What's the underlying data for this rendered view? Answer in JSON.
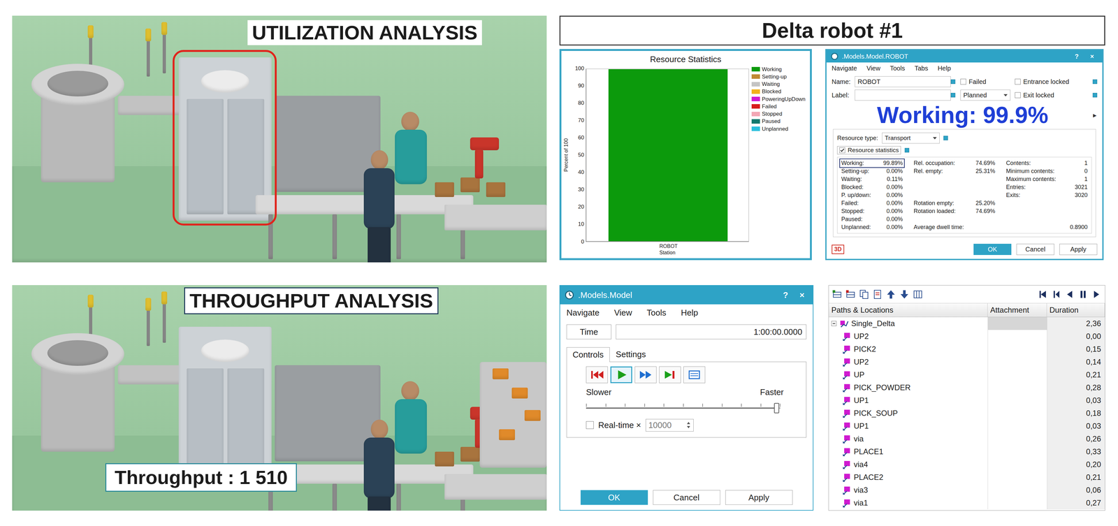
{
  "utilization_scene": {
    "title": "UTILIZATION ANALYSIS"
  },
  "throughput_scene": {
    "title": "THROUGHPUT ANALYSIS",
    "label": "Throughput : 1 510"
  },
  "header": {
    "title": "Delta robot #1"
  },
  "chart": {
    "title": "Resource Statistics",
    "y_axis_label": "Percent of 100",
    "y_ticks": [
      "100",
      "90",
      "80",
      "70",
      "60",
      "50",
      "40",
      "30",
      "20",
      "10",
      "0"
    ],
    "categories": [
      "ROBOT",
      "Station"
    ],
    "legend": [
      {
        "label": "Working",
        "color": "#0c9a0c"
      },
      {
        "label": "Setting-up",
        "color": "#c08a34"
      },
      {
        "label": "Waiting",
        "color": "#c4c4c4"
      },
      {
        "label": "Blocked",
        "color": "#f2b21c"
      },
      {
        "label": "PoweringUpDown",
        "color": "#d01ad0"
      },
      {
        "label": "Failed",
        "color": "#d81c1c"
      },
      {
        "label": "Stopped",
        "color": "#f3a7b5"
      },
      {
        "label": "Paused",
        "color": "#137a6e"
      },
      {
        "label": "Unplanned",
        "color": "#2bbfdc"
      }
    ],
    "series": [
      {
        "name": "Working",
        "values": [
          99.89
        ],
        "color": "#0c9a0c"
      },
      {
        "name": "Waiting",
        "values": [
          0.11
        ],
        "color": "#c4c4c4"
      }
    ]
  },
  "robot_dialog": {
    "title": ".Models.Model.ROBOT",
    "title_buttons": [
      "?",
      "×"
    ],
    "menu": [
      "Navigate",
      "View",
      "Tools",
      "Tabs",
      "Help"
    ],
    "name": {
      "label": "Name:",
      "value": "ROBOT"
    },
    "label": {
      "label": "Label:",
      "value": ""
    },
    "checks": [
      {
        "label": "Failed",
        "checked": false
      },
      {
        "label": "Entrance locked",
        "checked": false
      },
      {
        "label": "Exit locked",
        "checked": false
      }
    ],
    "mode": "Planned",
    "callout": "Working: 99.9%",
    "expand": "▸",
    "resource_type": {
      "label": "Resource type:",
      "value": "Transport"
    },
    "statistics": {
      "label": "Resource statistics",
      "checked": true
    },
    "stats_rows": [
      [
        {
          "kind": "pair",
          "label": "Working:",
          "value": "99.89%",
          "selected": true
        },
        {
          "kind": "pair",
          "label": "Rel. occupation:",
          "value": "74.69%",
          "selected": false
        },
        {
          "kind": "pair",
          "label": "Contents:",
          "value": "1",
          "selected": false
        }
      ],
      [
        {
          "kind": "pair",
          "label": "Setting-up:",
          "value": "0.00%",
          "selected": false
        },
        {
          "kind": "pair",
          "label": "Rel. empty:",
          "value": "25.31%",
          "selected": false
        },
        {
          "kind": "pair",
          "label": "Minimum contents:",
          "value": "0",
          "selected": false
        }
      ],
      [
        {
          "kind": "pair",
          "label": "Waiting:",
          "value": "0.11%",
          "selected": false
        },
        {
          "kind": "empty"
        },
        {
          "kind": "pair",
          "label": "Maximum contents:",
          "value": "1",
          "selected": false
        }
      ],
      [
        {
          "kind": "pair",
          "label": "Blocked:",
          "value": "0.00%",
          "selected": false
        },
        {
          "kind": "empty"
        },
        {
          "kind": "pair",
          "label": "Entries:",
          "value": "3021",
          "selected": false
        }
      ],
      [
        {
          "kind": "pair",
          "label": "P. up/down:",
          "value": "0.00%",
          "selected": false
        },
        {
          "kind": "empty"
        },
        {
          "kind": "pair",
          "label": "Exits:",
          "value": "3020",
          "selected": false
        }
      ],
      [
        {
          "kind": "pair",
          "label": "Failed:",
          "value": "0.00%",
          "selected": false
        },
        {
          "kind": "pair",
          "label": "Rotation empty:",
          "value": "25.20%",
          "selected": false
        },
        {
          "kind": "empty"
        }
      ],
      [
        {
          "kind": "pair",
          "label": "Stopped:",
          "value": "0.00%",
          "selected": false
        },
        {
          "kind": "pair",
          "label": "Rotation loaded:",
          "value": "74.69%",
          "selected": false
        },
        {
          "kind": "empty"
        }
      ],
      [
        {
          "kind": "pair",
          "label": "Paused:",
          "value": "0.00%",
          "selected": false
        },
        {
          "kind": "empty"
        },
        {
          "kind": "empty"
        }
      ],
      [
        {
          "kind": "pair",
          "label": "Unplanned:",
          "value": "0.00%",
          "selected": false
        },
        {
          "kind": "wide",
          "label": "Average dwell time:",
          "value": "0.8900",
          "selected": false
        }
      ]
    ],
    "tab_3d": "3D",
    "buttons": [
      "OK",
      "Cancel",
      "Apply"
    ]
  },
  "model_dialog": {
    "title": ".Models.Model",
    "title_buttons": [
      "?",
      "×"
    ],
    "menu": [
      "Navigate",
      "View",
      "Tools",
      "Help"
    ],
    "time": {
      "button": "Time",
      "value": "1:00:00.0000"
    },
    "tabs": [
      {
        "label": "Controls",
        "selected": true
      },
      {
        "label": "Settings",
        "selected": false
      }
    ],
    "controls": [
      {
        "kind": "reset",
        "selected": false
      },
      {
        "kind": "play",
        "selected": true
      },
      {
        "kind": "fast",
        "selected": false
      },
      {
        "kind": "step",
        "selected": false
      },
      {
        "kind": "list",
        "selected": false
      }
    ],
    "speed": {
      "min_label": "Slower",
      "max_label": "Faster",
      "level": 0.98
    },
    "realtime": {
      "label": "Real-time ×",
      "checked": false,
      "value": "10000"
    },
    "buttons": [
      "OK",
      "Cancel",
      "Apply"
    ]
  },
  "paths_table": {
    "columns": [
      "Paths & Locations",
      "Attachment",
      "Duration"
    ],
    "rows": [
      {
        "kind": "path",
        "name": "Single_Delta",
        "duration": "2,36",
        "expanded": true
      },
      {
        "kind": "location",
        "name": "UP2",
        "duration": "0,00"
      },
      {
        "kind": "location",
        "name": "PICK2",
        "duration": "0,15"
      },
      {
        "kind": "location",
        "name": "UP2",
        "duration": "0,14"
      },
      {
        "kind": "location",
        "name": "UP",
        "duration": "0,21"
      },
      {
        "kind": "location",
        "name": "PICK_POWDER",
        "duration": "0,28"
      },
      {
        "kind": "location",
        "name": "UP1",
        "duration": "0,03"
      },
      {
        "kind": "location",
        "name": "PICK_SOUP",
        "duration": "0,18"
      },
      {
        "kind": "location",
        "name": "UP1",
        "duration": "0,03"
      },
      {
        "kind": "location",
        "name": "via",
        "duration": "0,26"
      },
      {
        "kind": "location",
        "name": "PLACE1",
        "duration": "0,33"
      },
      {
        "kind": "location",
        "name": "via4",
        "duration": "0,20"
      },
      {
        "kind": "location",
        "name": "PLACE2",
        "duration": "0,21"
      },
      {
        "kind": "location",
        "name": "via3",
        "duration": "0,06"
      },
      {
        "kind": "location",
        "name": "via1",
        "duration": "0,27"
      }
    ]
  }
}
